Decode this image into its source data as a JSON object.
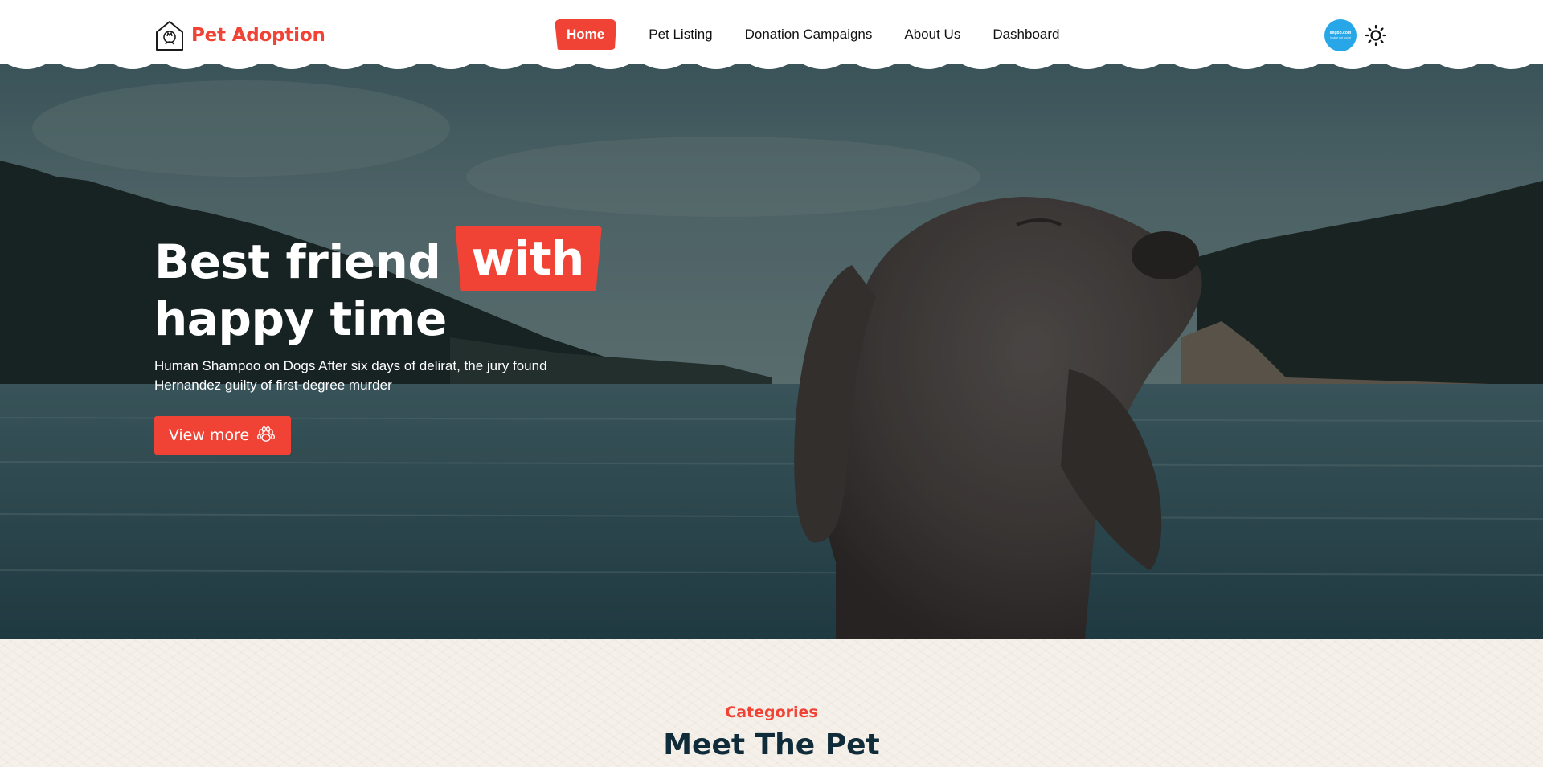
{
  "header": {
    "brand": "Pet Adoption",
    "nav": [
      {
        "label": "Home",
        "active": true
      },
      {
        "label": "Pet Listing",
        "active": false
      },
      {
        "label": "Donation Campaigns",
        "active": false
      },
      {
        "label": "About Us",
        "active": false
      },
      {
        "label": "Dashboard",
        "active": false
      }
    ],
    "avatar_text": [
      "imgbb.com",
      "Image not found"
    ],
    "theme_icon": "sun-icon"
  },
  "hero": {
    "title_part1": "Best friend",
    "title_highlight": "with",
    "title_line2": "happy time",
    "description": "Human Shampoo on Dogs After six days of delirat, the jury found Hernandez guilty of first-degree murder",
    "button_label": "View more",
    "button_icon": "paw-icon"
  },
  "categories": {
    "eyebrow": "Categories",
    "title": "Meet The Pet"
  },
  "colors": {
    "accent": "#f04336",
    "heading_dark": "#102c3a",
    "section_bg": "#f5f1ea",
    "avatar_bg": "#27a7e7"
  }
}
